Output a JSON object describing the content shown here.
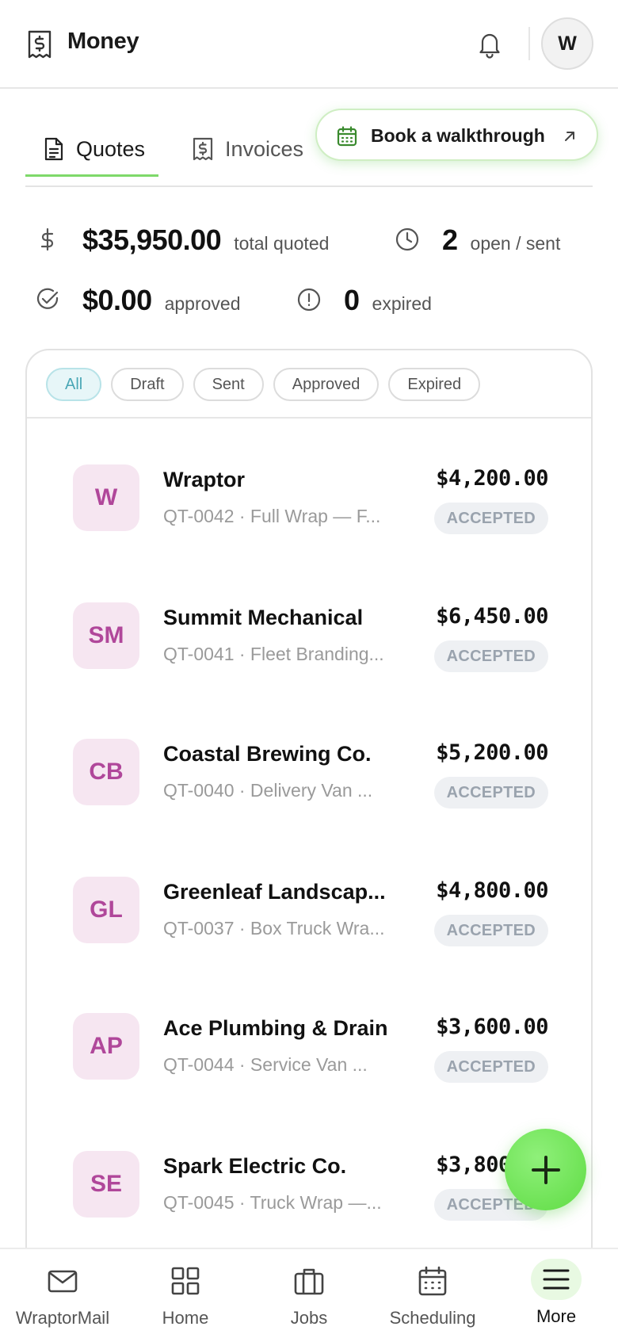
{
  "header": {
    "title": "Money",
    "avatar_initial": "W"
  },
  "tabs": [
    {
      "label": "Quotes",
      "icon": "document-icon",
      "active": true
    },
    {
      "label": "Invoices",
      "icon": "receipt-dollar-icon",
      "active": false
    }
  ],
  "walkthrough": {
    "label": "Book a walkthrough"
  },
  "stats": {
    "total_quoted": {
      "value": "$35,950.00",
      "label": "total quoted"
    },
    "open_sent": {
      "value": "2",
      "label": "open / sent"
    },
    "approved": {
      "value": "$0.00",
      "label": "approved"
    },
    "expired": {
      "value": "0",
      "label": "expired"
    }
  },
  "filters": [
    "All",
    "Draft",
    "Sent",
    "Approved",
    "Expired"
  ],
  "active_filter": "All",
  "quotes": [
    {
      "initials": "W",
      "name": "Wraptor",
      "sub": "QT-0042 · Full Wrap — F...",
      "amount": "$4,200.00",
      "status": "ACCEPTED"
    },
    {
      "initials": "SM",
      "name": "Summit Mechanical",
      "sub": "QT-0041 · Fleet Branding...",
      "amount": "$6,450.00",
      "status": "ACCEPTED"
    },
    {
      "initials": "CB",
      "name": "Coastal Brewing Co.",
      "sub": "QT-0040 · Delivery Van ...",
      "amount": "$5,200.00",
      "status": "ACCEPTED"
    },
    {
      "initials": "GL",
      "name": "Greenleaf Landscap...",
      "sub": "QT-0037 · Box Truck Wra...",
      "amount": "$4,800.00",
      "status": "ACCEPTED"
    },
    {
      "initials": "AP",
      "name": "Ace Plumbing & Drain",
      "sub": "QT-0044 · Service Van ...",
      "amount": "$3,600.00",
      "status": "ACCEPTED"
    },
    {
      "initials": "SE",
      "name": "Spark Electric Co.",
      "sub": "QT-0045 · Truck Wrap —...",
      "amount": "$3,800.00",
      "status": "ACCEPTED"
    }
  ],
  "bottom_nav": [
    {
      "label": "WraptorMail",
      "icon": "mail-icon"
    },
    {
      "label": "Home",
      "icon": "grid-icon"
    },
    {
      "label": "Jobs",
      "icon": "briefcase-icon"
    },
    {
      "label": "Scheduling",
      "icon": "calendar-icon"
    },
    {
      "label": "More",
      "icon": "menu-icon",
      "active": true
    }
  ],
  "colors": {
    "accent_green": "#7ed96a",
    "avatar_bg": "#f6e6f1",
    "avatar_text": "#b0479a",
    "badge_bg": "#eef0f3",
    "badge_text": "#9aa3ae",
    "active_chip_text": "#4aa7b6"
  }
}
